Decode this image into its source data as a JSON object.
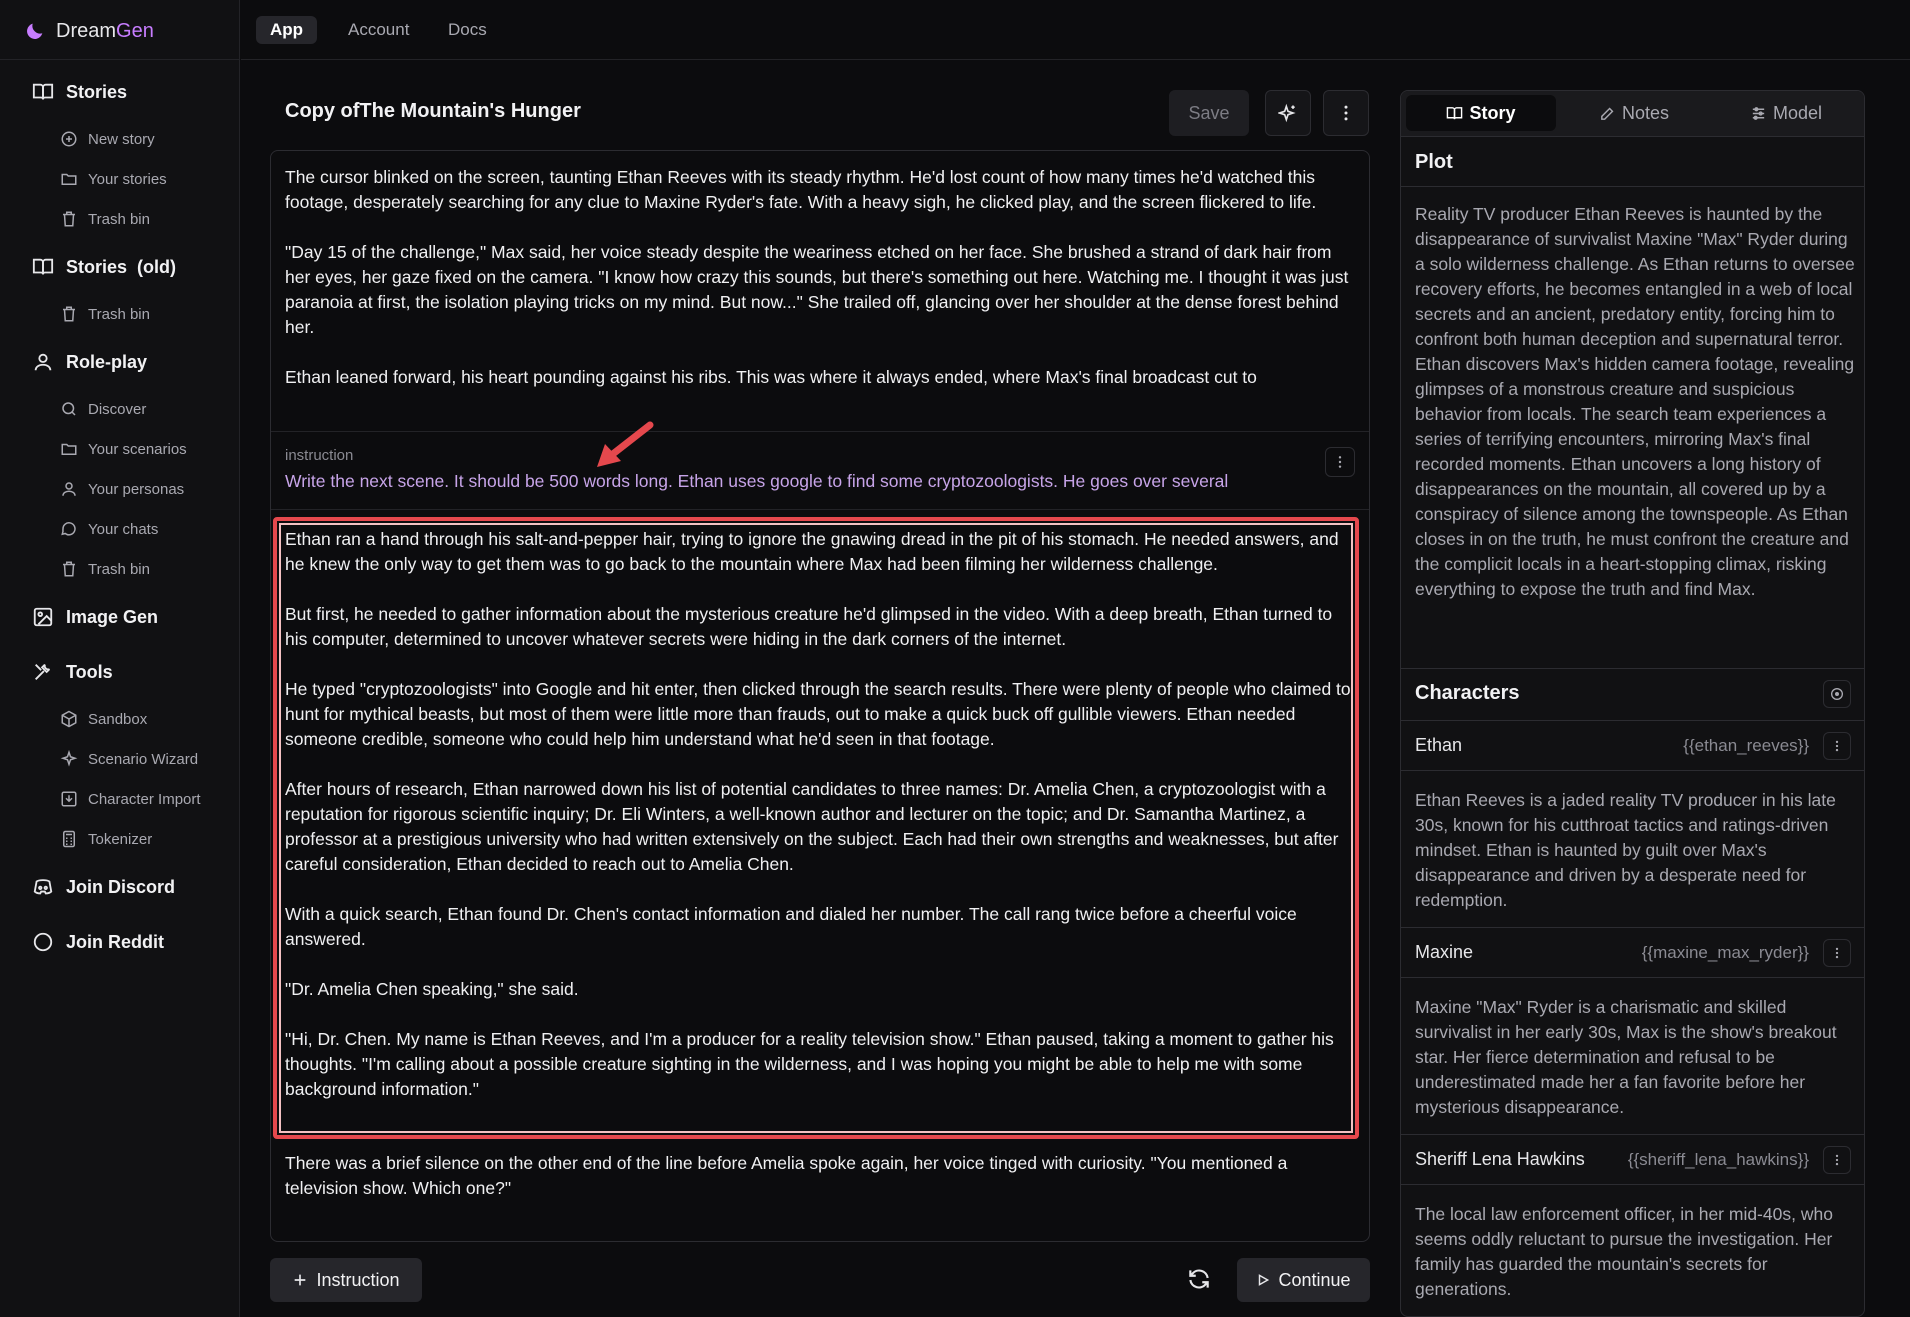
{
  "brand": {
    "part1": "Dream",
    "part2": "Gen",
    "accent": "#c77dff"
  },
  "sidebar": {
    "sections": [
      {
        "label": "Stories",
        "icon": "book-icon"
      },
      {
        "label": "Stories  (old)",
        "icon": "book-icon"
      },
      {
        "label": "Role-play",
        "icon": "user-icon"
      },
      {
        "label": "Image Gen",
        "icon": "images-icon"
      },
      {
        "label": "Tools",
        "icon": "tools-icon"
      },
      {
        "label": "Join Discord",
        "icon": "discord-icon"
      },
      {
        "label": "Join Reddit",
        "icon": "reddit-icon"
      }
    ],
    "items": [
      {
        "label": "New story",
        "icon": "plus-circle-icon"
      },
      {
        "label": "Your stories",
        "icon": "folder-icon"
      },
      {
        "label": "Trash bin",
        "icon": "trash-icon"
      },
      {
        "label": "Trash bin",
        "icon": "trash-icon"
      },
      {
        "label": "Discover",
        "icon": "search-icon"
      },
      {
        "label": "Your scenarios",
        "icon": "folder-icon"
      },
      {
        "label": "Your personas",
        "icon": "user-icon"
      },
      {
        "label": "Your chats",
        "icon": "chat-icon"
      },
      {
        "label": "Trash bin",
        "icon": "trash-icon"
      },
      {
        "label": "Sandbox",
        "icon": "box-icon"
      },
      {
        "label": "Scenario Wizard",
        "icon": "sparkle-icon"
      },
      {
        "label": "Character Import",
        "icon": "import-icon"
      },
      {
        "label": "Tokenizer",
        "icon": "calculator-icon"
      }
    ]
  },
  "topnav": {
    "tabs": [
      "App",
      "Account",
      "Docs"
    ],
    "active": "App"
  },
  "editor": {
    "title": "Copy ofThe Mountain's Hunger",
    "save_label": "Save",
    "block1": "The cursor blinked on the screen, taunting Ethan Reeves with its steady rhythm. He'd lost count of how many times he'd watched this footage, desperately searching for any clue to Maxine Ryder's fate. With a heavy sigh, he clicked play, and the screen flickered to life.\n\n\"Day 15 of the challenge,\" Max said, her voice steady despite the weariness etched on her face. She brushed a strand of dark hair from her eyes, her gaze fixed on the camera. \"I know how crazy this sounds, but there's something out here. Watching me. I thought it was just paranoia at first, the isolation playing tricks on my mind. But now...\" She trailed off, glancing over her shoulder at the dense forest behind her.\n\nEthan leaned forward, his heart pounding against his ribs. This was where it always ended, where Max's final broadcast cut to",
    "instruction_label": "instruction",
    "instruction_text": "Write the next scene. It should be 500 words long. Ethan uses google to find some cryptozoologists. He goes over several",
    "block2": "Ethan ran a hand through his salt-and-pepper hair, trying to ignore the gnawing dread in the pit of his stomach. He needed answers, and he knew the only way to get them was to go back to the mountain where Max had been filming her wilderness challenge.\n\nBut first, he needed to gather information about the mysterious creature he'd glimpsed in the video. With a deep breath, Ethan turned to his computer, determined to uncover whatever secrets were hiding in the dark corners of the internet.\n\nHe typed \"cryptozoologists\" into Google and hit enter, then clicked through the search results. There were plenty of people who claimed to hunt for mythical beasts, but most of them were little more than frauds, out to make a quick buck off gullible viewers. Ethan needed someone credible, someone who could help him understand what he'd seen in that footage.\n\nAfter hours of research, Ethan narrowed down his list of potential candidates to three names: Dr. Amelia Chen, a cryptozoologist with a reputation for rigorous scientific inquiry; Dr. Eli Winters, a well-known author and lecturer on the topic; and Dr. Samantha Martinez, a professor at a prestigious university who had written extensively on the subject. Each had their own strengths and weaknesses, but after careful consideration, Ethan decided to reach out to Amelia Chen.\n\nWith a quick search, Ethan found Dr. Chen's contact information and dialed her number. The call rang twice before a cheerful voice answered.\n\n\"Dr. Amelia Chen speaking,\" she said.\n\n\"Hi, Dr. Chen. My name is Ethan Reeves, and I'm a producer for a reality television show.\" Ethan paused, taking a moment to gather his thoughts. \"I'm calling about a possible creature sighting in the wilderness, and I was hoping you might be able to help me with some background information.\"",
    "block3": "There was a brief silence on the other end of the line before Amelia spoke again, her voice tinged with curiosity. \"You mentioned a television show. Which one?\"",
    "instruction_button": "Instruction",
    "continue_button": "Continue",
    "highlight_color": "#e5484d"
  },
  "panel": {
    "tabs": [
      "Story",
      "Notes",
      "Model"
    ],
    "active_tab": "Story",
    "plot_heading": "Plot",
    "plot_text": "Reality TV producer Ethan Reeves is haunted by the disappearance of survivalist Maxine \"Max\" Ryder during a solo wilderness challenge. As Ethan returns to oversee recovery efforts, he becomes entangled in a web of local secrets and an ancient, predatory entity, forcing him to confront both human deception and supernatural terror. Ethan discovers Max's hidden camera footage, revealing glimpses of a monstrous creature and suspicious behavior from locals. The search team experiences a series of terrifying encounters, mirroring Max's final recorded moments. Ethan uncovers a long history of disappearances on the mountain, all covered up by a conspiracy of silence among the townspeople. As Ethan closes in on the truth, he must confront the creature and the complicit locals in a heart-stopping climax, risking everything to expose the truth and find Max.",
    "characters_heading": "Characters",
    "characters": [
      {
        "name": "Ethan",
        "handle": "{{ethan_reeves}}",
        "description": "Ethan Reeves is a jaded reality TV producer in his late 30s, known for his cutthroat tactics and ratings-driven mindset. Ethan is haunted by guilt over Max's disappearance and driven by a desperate need for redemption."
      },
      {
        "name": "Maxine",
        "handle": "{{maxine_max_ryder}}",
        "description": "Maxine \"Max\" Ryder is a charismatic and skilled survivalist in her early 30s, Max is the show's breakout star. Her fierce determination and refusal to be underestimated made her a fan favorite before her mysterious disappearance."
      },
      {
        "name": "Sheriff Lena Hawkins",
        "handle": "{{sheriff_lena_hawkins}}",
        "description": "The local law enforcement officer, in her mid-40s, who seems oddly reluctant to pursue the investigation. Her family has guarded the mountain's secrets for generations."
      }
    ]
  }
}
